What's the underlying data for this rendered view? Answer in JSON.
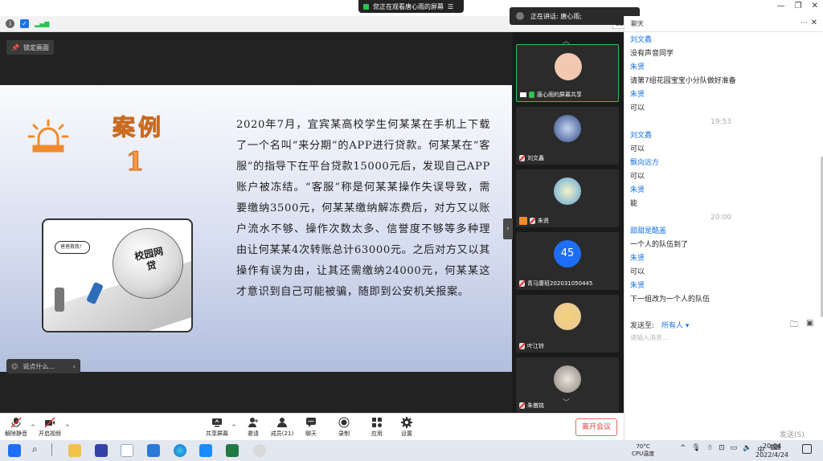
{
  "screen_share_banner": "您正在观看唐心雨的屏幕",
  "speaker_indicator": "正在讲话: 唐心雨;",
  "zoom_value": "35",
  "lock_view": "锁定画面",
  "slide": {
    "case_title": "案例",
    "case_number": "1",
    "body": "2020年7月，宜宾某高校学生何某某在手机上下载了一个名叫“来分期”的APP进行贷款。何某某在“客服”的指导下在平台贷款15000元后，发现自己APP账户被冻结。“客服”称是何某某操作失误导致，需要缴纳3500元，何某某缴纳解冻费后，对方又以账户流水不够、操作次数太多、信誉度不够等多种理由让何某某4次转账总计63000元。之后对方又以其操作有误为由，让其还需缴纳24000元，何某某这才意识到自己可能被骗，随即到公安机关报案。",
    "cartoon_speech": "爸爸救我！",
    "cartoon_ball": "校园网贷"
  },
  "chat_input_hint": "说点什么...",
  "participants": [
    {
      "name": "唐心雨的屏幕共享",
      "avatar_color": "#f2c9b0"
    },
    {
      "name": "刘文鑫",
      "avatar_color": "#2f4a86"
    },
    {
      "name": "朱贤",
      "avatar_color": "#5aa6d8"
    },
    {
      "name": "青马康班202031050445",
      "count": "45"
    },
    {
      "name": "叶江铃",
      "avatar_color": "#e8c79a"
    },
    {
      "name": "朱傲铭",
      "avatar_color": "#b8b4ad"
    }
  ],
  "chat": {
    "header": "聊天",
    "messages": [
      {
        "sender": "刘文鑫",
        "text": "没有声音同学"
      },
      {
        "sender": "朱贤",
        "text": "请第7组花园宝宝小分队做好准备"
      },
      {
        "sender": "朱贤",
        "text": "可以"
      },
      {
        "time": "19:53"
      },
      {
        "sender": "刘文鑫",
        "text": "可以"
      },
      {
        "sender": "飘向远方",
        "text": "可以"
      },
      {
        "sender": "朱贤",
        "text": "能"
      },
      {
        "time": "20:00"
      },
      {
        "sender": "甜甜是酷盖",
        "text": "一个人的队伍到了"
      },
      {
        "sender": "朱贤",
        "text": "可以"
      },
      {
        "sender": "朱贤",
        "text": "下一组改为一个人的队伍"
      }
    ],
    "send_to_label": "发送至:",
    "send_to_value": "所有人",
    "input_placeholder": "请输入消息...",
    "send_button": "发送(S)"
  },
  "toolbar": {
    "unmute": "解除静音",
    "start_video": "开启视频",
    "share_screen": "共享屏幕",
    "invite": "邀请",
    "members": "成员(21)",
    "chat": "聊天",
    "record": "录制",
    "apps": "应用",
    "settings": "设置",
    "leave": "离开会议"
  },
  "taskbar": {
    "temperature": "70°C",
    "temp_label": "CPU温度",
    "ime": "中",
    "time": "20:04",
    "date": "2022/4/24"
  },
  "colors": {
    "accent_green": "#2bc452",
    "chat_sender_blue": "#1a73e8",
    "leave_red": "#e04040",
    "case_orange": "#f29a4a"
  }
}
